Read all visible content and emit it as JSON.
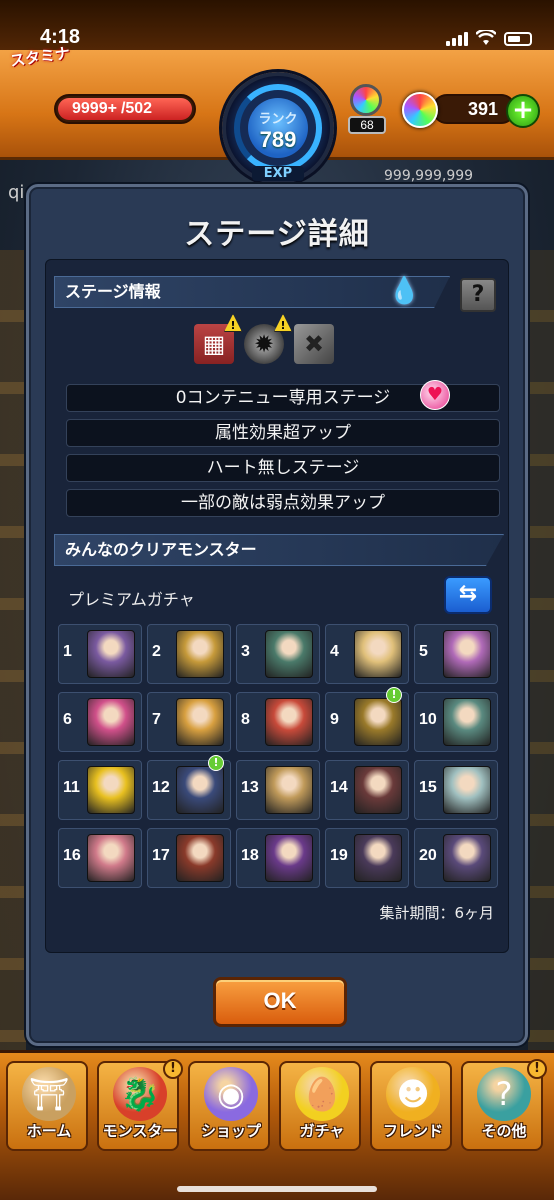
{
  "status_bar": {
    "time": "4:18"
  },
  "hud": {
    "stamina_label": "スタミナ",
    "stamina_current": "9999+",
    "stamina_max": "/502",
    "rank_label": "ランク",
    "rank_value": "789",
    "exp_label": "EXP",
    "gem_pot_count": "68",
    "orb_count": "391",
    "add_orb": "+"
  },
  "background": {
    "player_name": "qi",
    "coins": "999,999,999"
  },
  "modal": {
    "title": "ステージ詳細",
    "stage_info_header": "ステージ情報",
    "help_label": "?",
    "gimmicks": [
      {
        "icon": "damage-wall-icon",
        "glyph": "▦",
        "warning": "!"
      },
      {
        "icon": "mine-icon",
        "glyph": "✹",
        "warning": "!"
      },
      {
        "icon": "block-icon",
        "glyph": "✖"
      }
    ],
    "rules": [
      "0コンテニュー専用ステージ",
      "属性効果超アップ",
      "ハート無しステージ",
      "一部の敵は弱点効果アップ"
    ],
    "clear_header": "みんなのクリアモンスター",
    "gacha_label": "プレミアムガチャ",
    "swap_label": "⇆",
    "monsters": [
      {
        "rank": "1",
        "color": "#7a5aa0"
      },
      {
        "rank": "2",
        "color": "#c69a3a"
      },
      {
        "rank": "3",
        "color": "#4a7a6a"
      },
      {
        "rank": "4",
        "color": "#e0c07a"
      },
      {
        "rank": "5",
        "color": "#b06ab8"
      },
      {
        "rank": "6",
        "color": "#d0508a"
      },
      {
        "rank": "7",
        "color": "#d8a040"
      },
      {
        "rank": "8",
        "color": "#c84a3a"
      },
      {
        "rank": "9",
        "color": "#9a7a2a",
        "badge": "!"
      },
      {
        "rank": "10",
        "color": "#5a8a80"
      },
      {
        "rank": "11",
        "color": "#e8c020"
      },
      {
        "rank": "12",
        "color": "#3a4a7a",
        "badge": "!"
      },
      {
        "rank": "13",
        "color": "#c09a5a"
      },
      {
        "rank": "14",
        "color": "#6a3a3a"
      },
      {
        "rank": "15",
        "color": "#a0c0c0"
      },
      {
        "rank": "16",
        "color": "#d07a8a"
      },
      {
        "rank": "17",
        "color": "#8a3a2a"
      },
      {
        "rank": "18",
        "color": "#6a3a8a"
      },
      {
        "rank": "19",
        "color": "#4a3a5a"
      },
      {
        "rank": "20",
        "color": "#5a4a7a"
      }
    ],
    "period_label": "集計期間：6ヶ月",
    "ok_label": "OK"
  },
  "bottom_nav": [
    {
      "label": "ホーム",
      "icon": "home-gate-icon",
      "glyph": "⛩",
      "color": "#c9a060"
    },
    {
      "label": "モンスター",
      "icon": "dragon-icon",
      "glyph": "🐉",
      "color": "#d8402a",
      "badge": "!"
    },
    {
      "label": "ショップ",
      "icon": "rainbow-orb-icon",
      "glyph": "◉",
      "color": "#8a6ae0"
    },
    {
      "label": "ガチャ",
      "icon": "egg-icon",
      "glyph": "🥚",
      "color": "#f2d020"
    },
    {
      "label": "フレンド",
      "icon": "friends-icon",
      "glyph": "☻",
      "color": "#f0b020"
    },
    {
      "label": "その他",
      "icon": "other-icon",
      "glyph": "?",
      "color": "#3aa0a0",
      "badge": "!"
    }
  ]
}
